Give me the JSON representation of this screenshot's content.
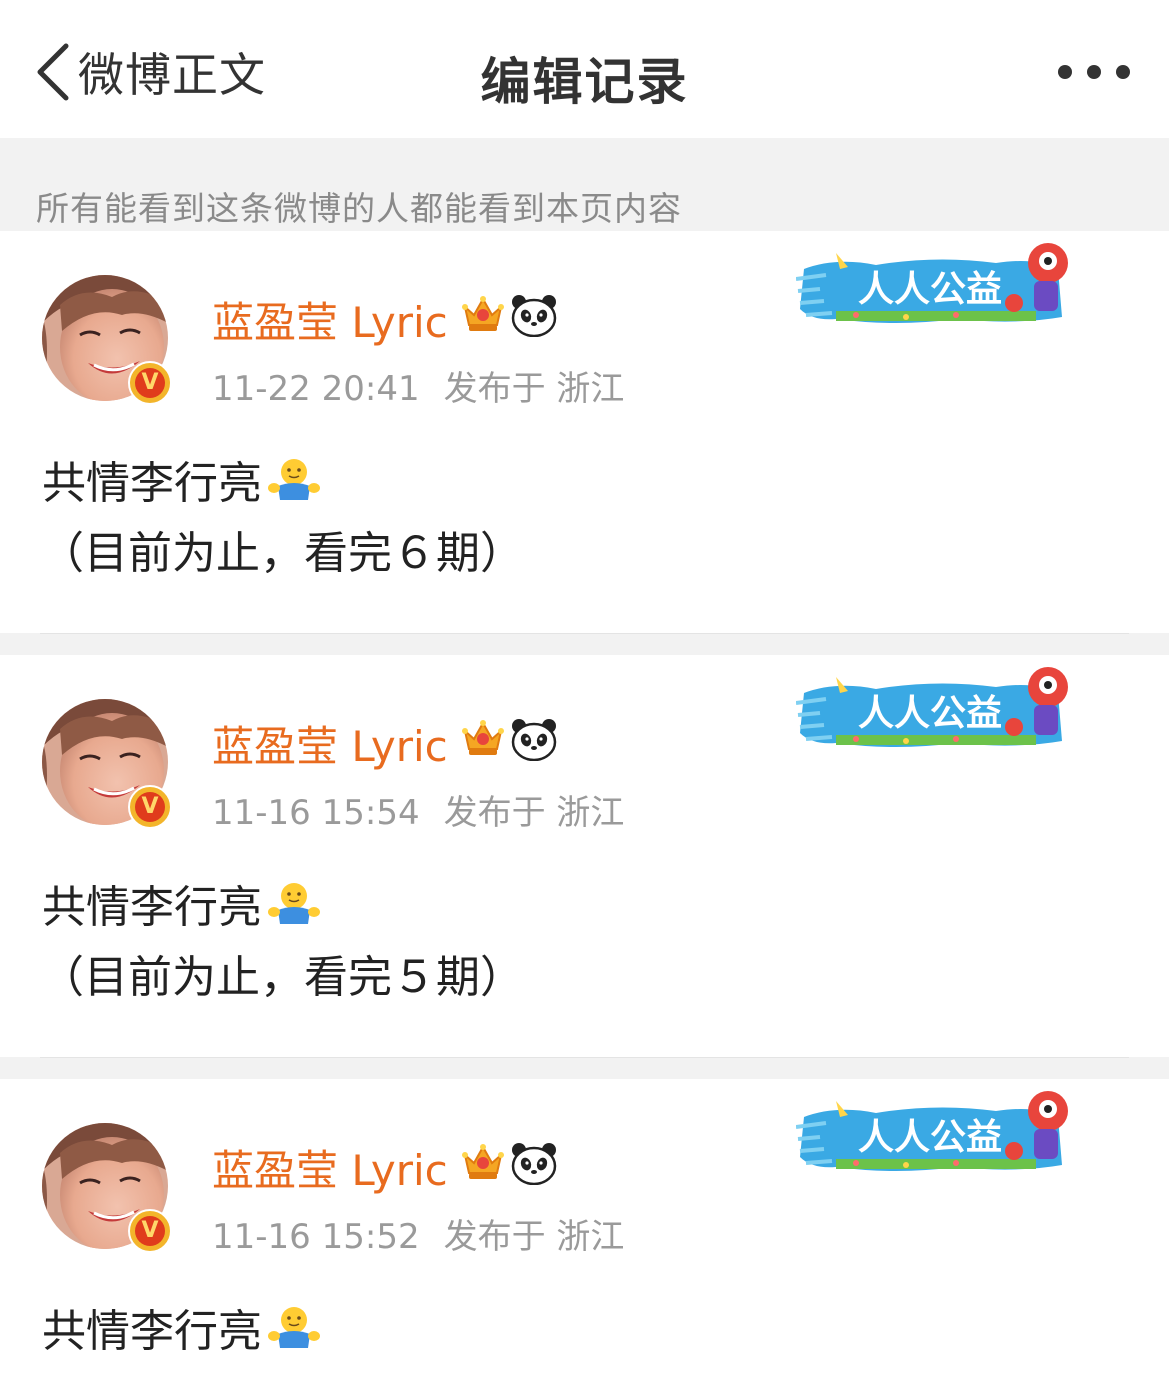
{
  "navbar": {
    "back_label": "微博正文",
    "title": "编辑记录"
  },
  "notice": "所有能看到这条微博的人都能看到本页内容",
  "badge_text": "人人公益",
  "posts": [
    {
      "username": "蓝盈莹 Lyric",
      "time": "11-22 20:41",
      "location": "发布于 浙江",
      "line1": "共情李行亮",
      "line2": "（目前为止，看完６期）"
    },
    {
      "username": "蓝盈莹 Lyric",
      "time": "11-16 15:54",
      "location": "发布于 浙江",
      "line1": "共情李行亮",
      "line2": "（目前为止，看完５期）"
    },
    {
      "username": "蓝盈莹 Lyric",
      "time": "11-16 15:52",
      "location": "发布于 浙江",
      "line1": "共情李行亮",
      "line2": ""
    }
  ],
  "icons": {
    "back": "chevron-left-icon",
    "more": "more-dots-icon",
    "verified": "verified-v-icon",
    "member": "crown-icon",
    "fan": "panda-icon",
    "emoji": "hug-emoji-icon"
  },
  "colors": {
    "username": "#e86b1f",
    "meta": "#9a9a9a",
    "separator": "#f2f2f2",
    "badge_blue": "#3aa9e4"
  }
}
